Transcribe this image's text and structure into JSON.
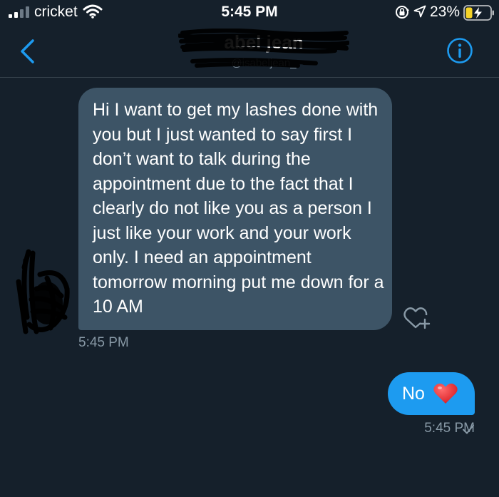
{
  "status_bar": {
    "carrier": "cricket",
    "time": "5:45 PM",
    "battery_percent": "23%",
    "icons": [
      "signal-icon",
      "wifi-icon",
      "orientation-lock-icon",
      "location-icon",
      "battery-charging-icon"
    ]
  },
  "header": {
    "contact_name": "abel jean",
    "contact_handle": "@isabeljean_",
    "back_icon": "chevron-left-icon",
    "info_icon": "info-icon"
  },
  "messages": [
    {
      "direction": "incoming",
      "text": "Hi I want to get my lashes done with you but I just wanted to say first I don’t want to talk during the appointment due to the fact that I clearly do not like you as a person I just like your work and your work only. I need an appointment tomorrow morning put me down for a 10 AM",
      "time": "5:45 PM"
    },
    {
      "direction": "outgoing",
      "text": "No",
      "emoji": "red-heart",
      "time": "5:45 PM"
    }
  ],
  "colors": {
    "background": "#15202b",
    "incoming_bubble": "#3d5466",
    "outgoing_bubble": "#1d9bf0",
    "accent": "#1d9bf0",
    "muted_text": "#8899a6"
  }
}
